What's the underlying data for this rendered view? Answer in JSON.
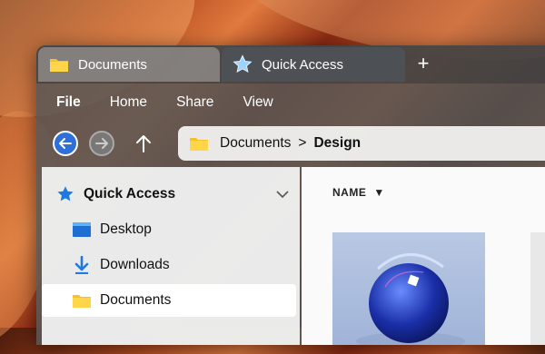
{
  "tabs": [
    {
      "label": "Documents",
      "icon": "folder-icon"
    },
    {
      "label": "Quick Access",
      "icon": "star-icon"
    }
  ],
  "new_tab_label": "+",
  "menu": [
    "File",
    "Home",
    "Share",
    "View"
  ],
  "breadcrumb": {
    "parent": "Documents",
    "separator": ">",
    "current": "Design"
  },
  "sidebar": {
    "header": "Quick Access",
    "items": [
      {
        "label": "Desktop",
        "icon": "desktop-icon"
      },
      {
        "label": "Downloads",
        "icon": "download-icon"
      },
      {
        "label": "Documents",
        "icon": "folder-icon"
      }
    ]
  },
  "content": {
    "column_header": "NAME",
    "sort_indicator": "▼"
  },
  "colors": {
    "accent_blue": "#2f6fd8",
    "folder_yellow": "#f6c12b",
    "star_blue": "#1f7ae0"
  }
}
